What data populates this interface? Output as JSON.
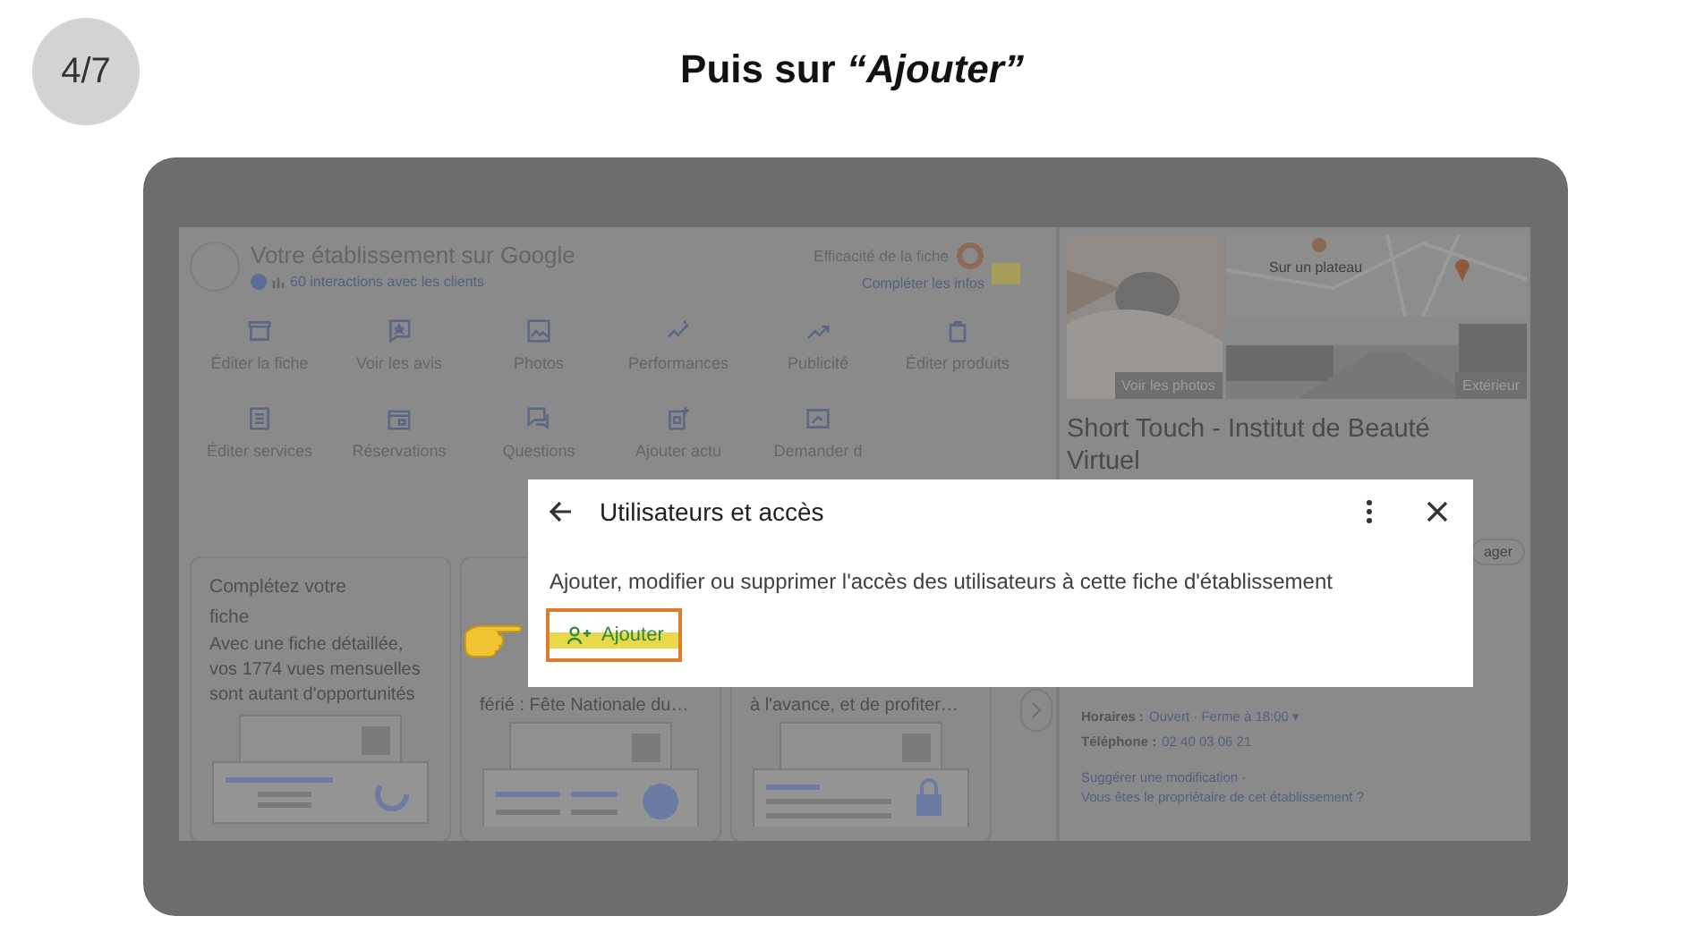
{
  "step_badge": "4/7",
  "heading": "Puis sur *“Ajouter”*",
  "screenshot": {
    "header": {
      "title": "Votre établissement sur Google",
      "interactions": "60 interactions avec les clients",
      "efficiency_label": "Efficacité de la fiche",
      "complete_link": "Compléter les infos"
    },
    "actions": [
      {
        "label": "Éditer la fiche"
      },
      {
        "label": "Voir les avis"
      },
      {
        "label": "Photos"
      },
      {
        "label": "Performances"
      },
      {
        "label": "Publicité"
      },
      {
        "label": "Éditer produits"
      },
      {
        "label": "Éditer services"
      },
      {
        "label": "Réservations"
      },
      {
        "label": "Questions"
      },
      {
        "label": "Ajouter actu"
      },
      {
        "label": "Demander d"
      }
    ],
    "cards": [
      {
        "title": "Complétez votre fiche",
        "body": "Avec une fiche détaillée, vos 1774 vues mensuelles sont autant d'opportunités"
      },
      {
        "body": "férié : Fête Nationale du…"
      },
      {
        "body": "à l'avance, et de profiter…"
      }
    ],
    "business": {
      "photos_label": "Voir les photos",
      "map_label": "Sur un plateau",
      "exterior_label": "Extérieur",
      "name": "Short Touch - Institut de Beauté Virtuel",
      "share_fragment": "ager",
      "hours_label": "Horaires :",
      "hours_value": "Ouvert · Ferme à 18:00 ▾",
      "phone_label": "Téléphone :",
      "phone_value": "02 40 03 06 21",
      "suggest_link": "Suggérer une modification ·",
      "owner_link": "Vous êtes le propriétaire de cet établissement ?"
    },
    "dialog": {
      "title": "Utilisateurs et accès",
      "description": "Ajouter, modifier ou supprimer l'accès des utilisateurs à cette fiche d'établissement",
      "add_button": "Ajouter"
    }
  }
}
